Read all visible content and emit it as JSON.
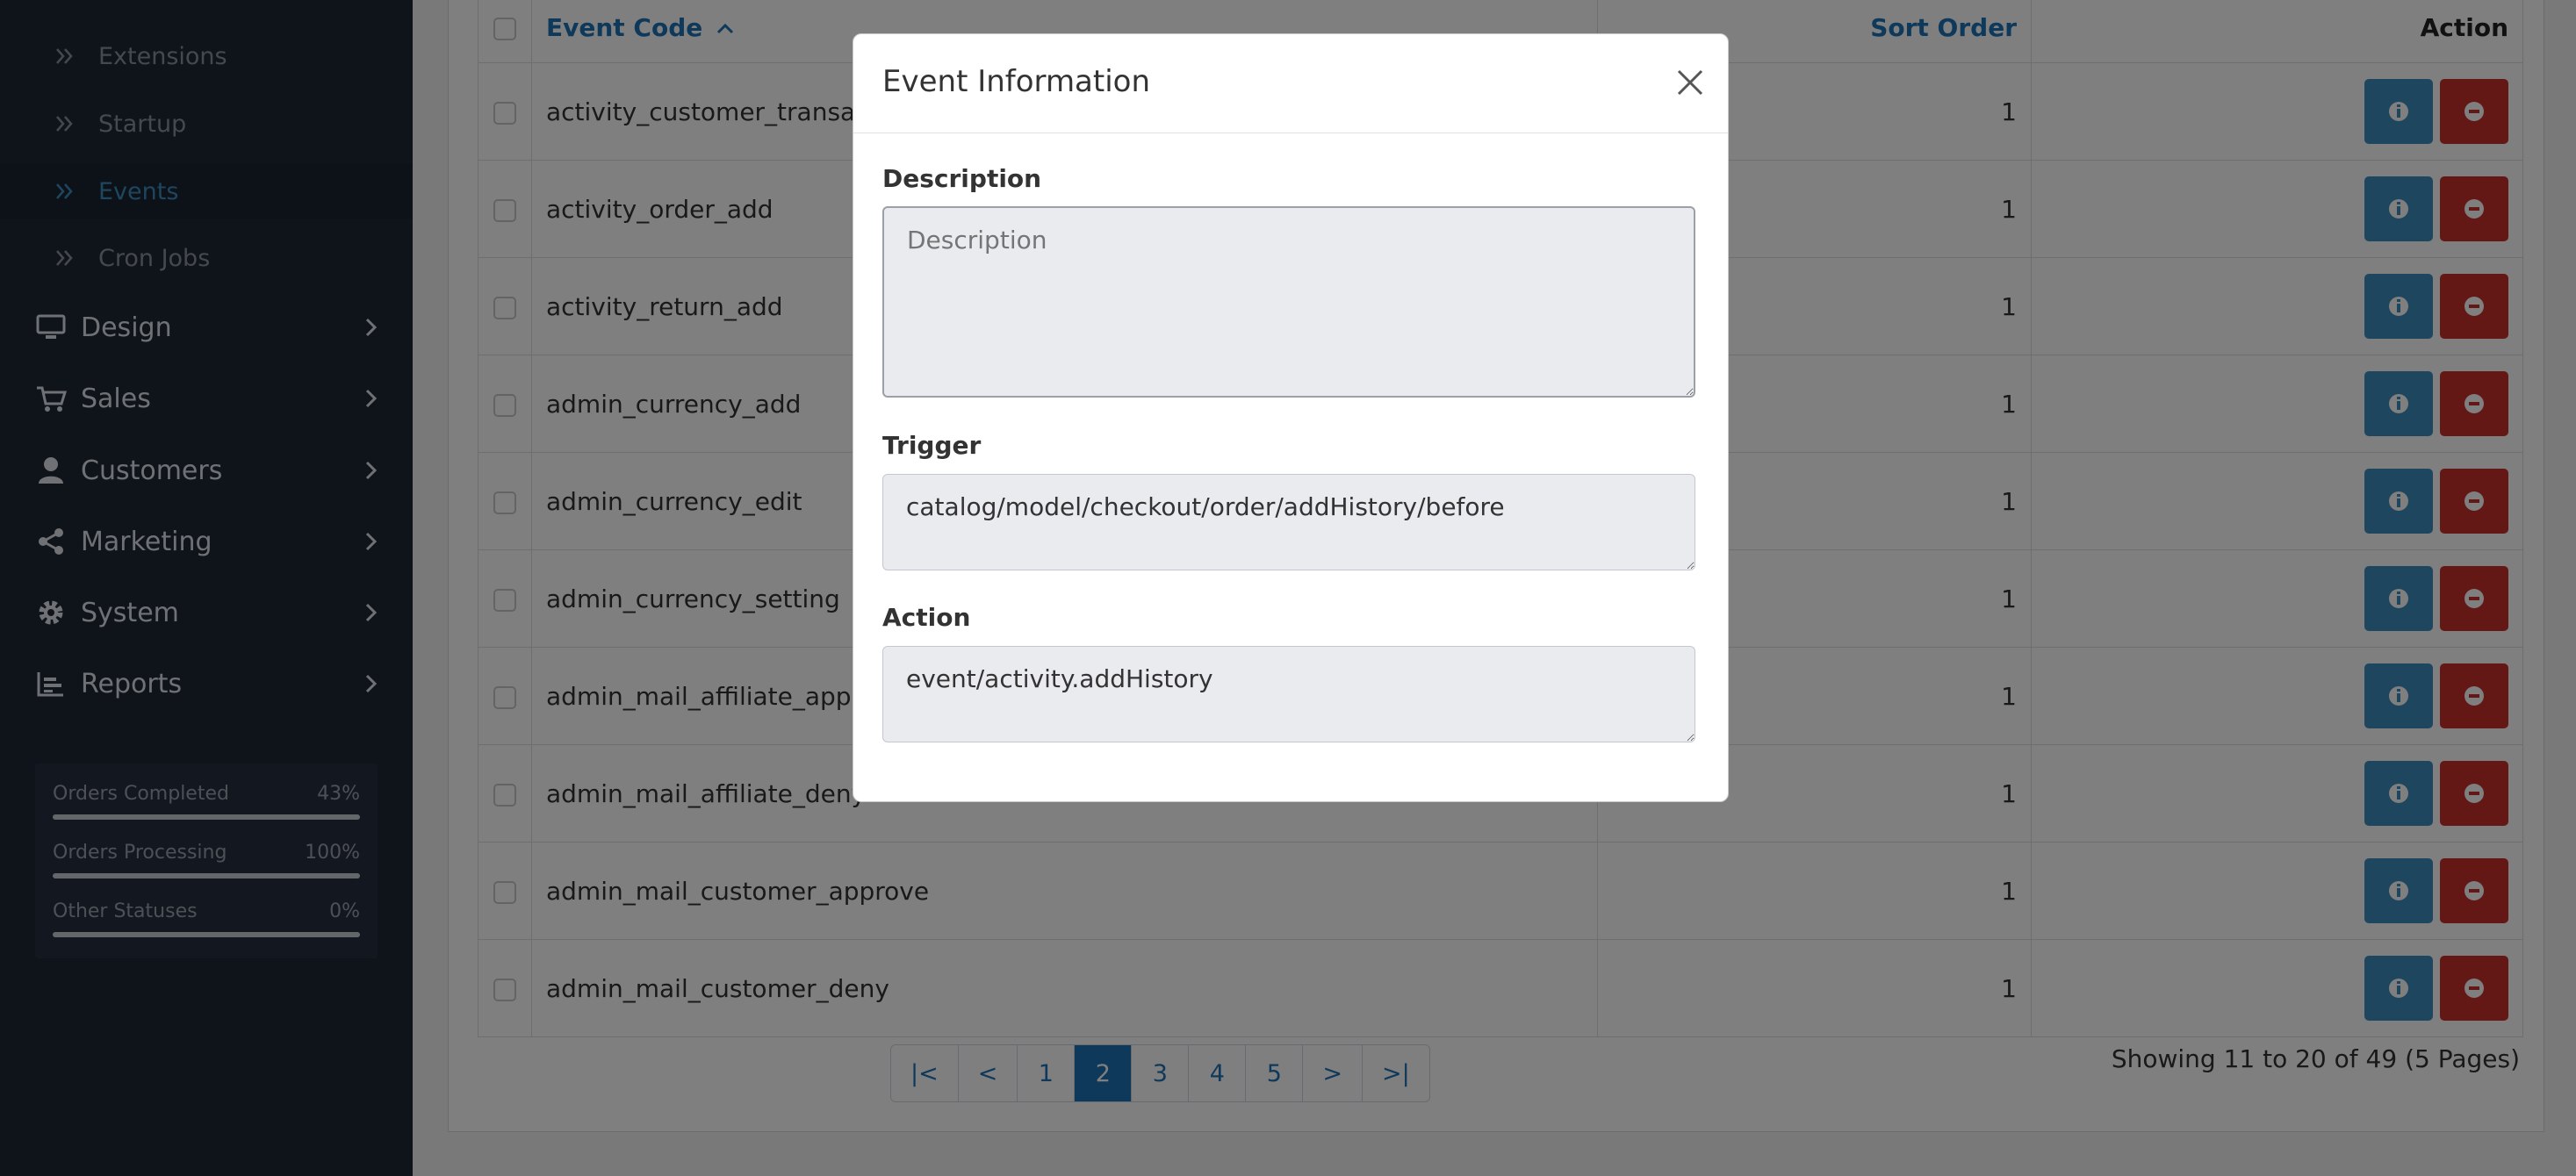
{
  "sidebar": {
    "sub_items": [
      {
        "label": "Extensions",
        "active": false
      },
      {
        "label": "Startup",
        "active": false
      },
      {
        "label": "Events",
        "active": true
      },
      {
        "label": "Cron Jobs",
        "active": false
      }
    ],
    "main_items": [
      {
        "label": "Design",
        "icon": "monitor-icon"
      },
      {
        "label": "Sales",
        "icon": "cart-icon"
      },
      {
        "label": "Customers",
        "icon": "user-icon"
      },
      {
        "label": "Marketing",
        "icon": "share-icon"
      },
      {
        "label": "System",
        "icon": "gear-icon"
      },
      {
        "label": "Reports",
        "icon": "bar-chart-icon"
      }
    ],
    "stats": [
      {
        "label": "Orders Completed",
        "value": "43%",
        "fraction": 1.0
      },
      {
        "label": "Orders Processing",
        "value": "100%",
        "fraction": 1.0
      },
      {
        "label": "Other Statuses",
        "value": "0%",
        "fraction": 1.0
      }
    ]
  },
  "table": {
    "headers": {
      "event_code": "Event Code",
      "sort_order": "Sort Order",
      "action": "Action"
    },
    "rows": [
      {
        "code": "activity_customer_transaction",
        "sort": "1"
      },
      {
        "code": "activity_order_add",
        "sort": "1"
      },
      {
        "code": "activity_return_add",
        "sort": "1"
      },
      {
        "code": "admin_currency_add",
        "sort": "1"
      },
      {
        "code": "admin_currency_edit",
        "sort": "1"
      },
      {
        "code": "admin_currency_setting",
        "sort": "1"
      },
      {
        "code": "admin_mail_affiliate_approve",
        "sort": "1"
      },
      {
        "code": "admin_mail_affiliate_deny",
        "sort": "1"
      },
      {
        "code": "admin_mail_customer_approve",
        "sort": "1"
      },
      {
        "code": "admin_mail_customer_deny",
        "sort": "1"
      }
    ]
  },
  "pagination": {
    "pages": [
      "|<",
      "<",
      "1",
      "2",
      "3",
      "4",
      "5",
      ">",
      ">|"
    ],
    "current": "2",
    "summary": "Showing 11 to 20 of 49 (5 Pages)"
  },
  "modal": {
    "title": "Event Information",
    "description_label": "Description",
    "description_placeholder": "Description",
    "description_value": "",
    "trigger_label": "Trigger",
    "trigger_value": "catalog/model/checkout/order/addHistory/before",
    "action_label": "Action",
    "action_value": "event/activity.addHistory"
  },
  "colors": {
    "sidebar_bg": "#1f2937",
    "accent": "#1f73b7",
    "info_button": "#3c8dbc",
    "danger_button": "#c9302c"
  }
}
